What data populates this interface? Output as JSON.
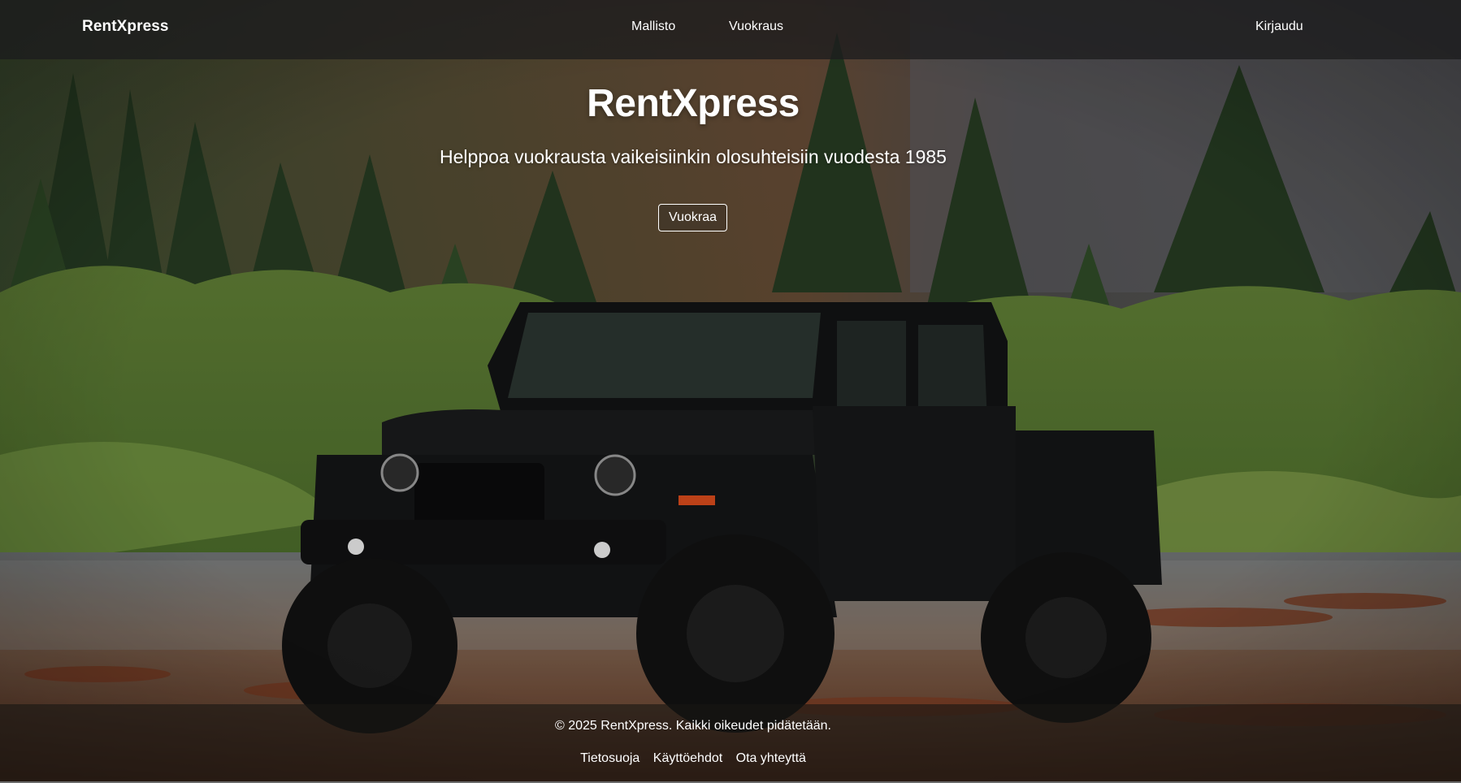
{
  "header": {
    "brand": "RentXpress",
    "nav": {
      "models": "Mallisto",
      "rental": "Vuokraus",
      "login": "Kirjaudu"
    }
  },
  "hero": {
    "title": "RentXpress",
    "subtitle": "Helppoa vuokrausta vaikeisiinkin olosuhteisiin vuodesta 1985",
    "button": "Vuokraa"
  },
  "footer": {
    "copyright": "© 2025 RentXpress. Kaikki oikeudet pidätetään.",
    "links": {
      "privacy": "Tietosuoja",
      "terms": "Käyttöehdot",
      "contact": "Ota yhteyttä"
    }
  },
  "background": {
    "image_subject": "black-pickup-truck-forest-scene",
    "colors": {
      "header_overlay": "#1c1c1e",
      "forest": "#3e5a2a",
      "truck": "#151617",
      "ground": "#6b3a22"
    }
  }
}
